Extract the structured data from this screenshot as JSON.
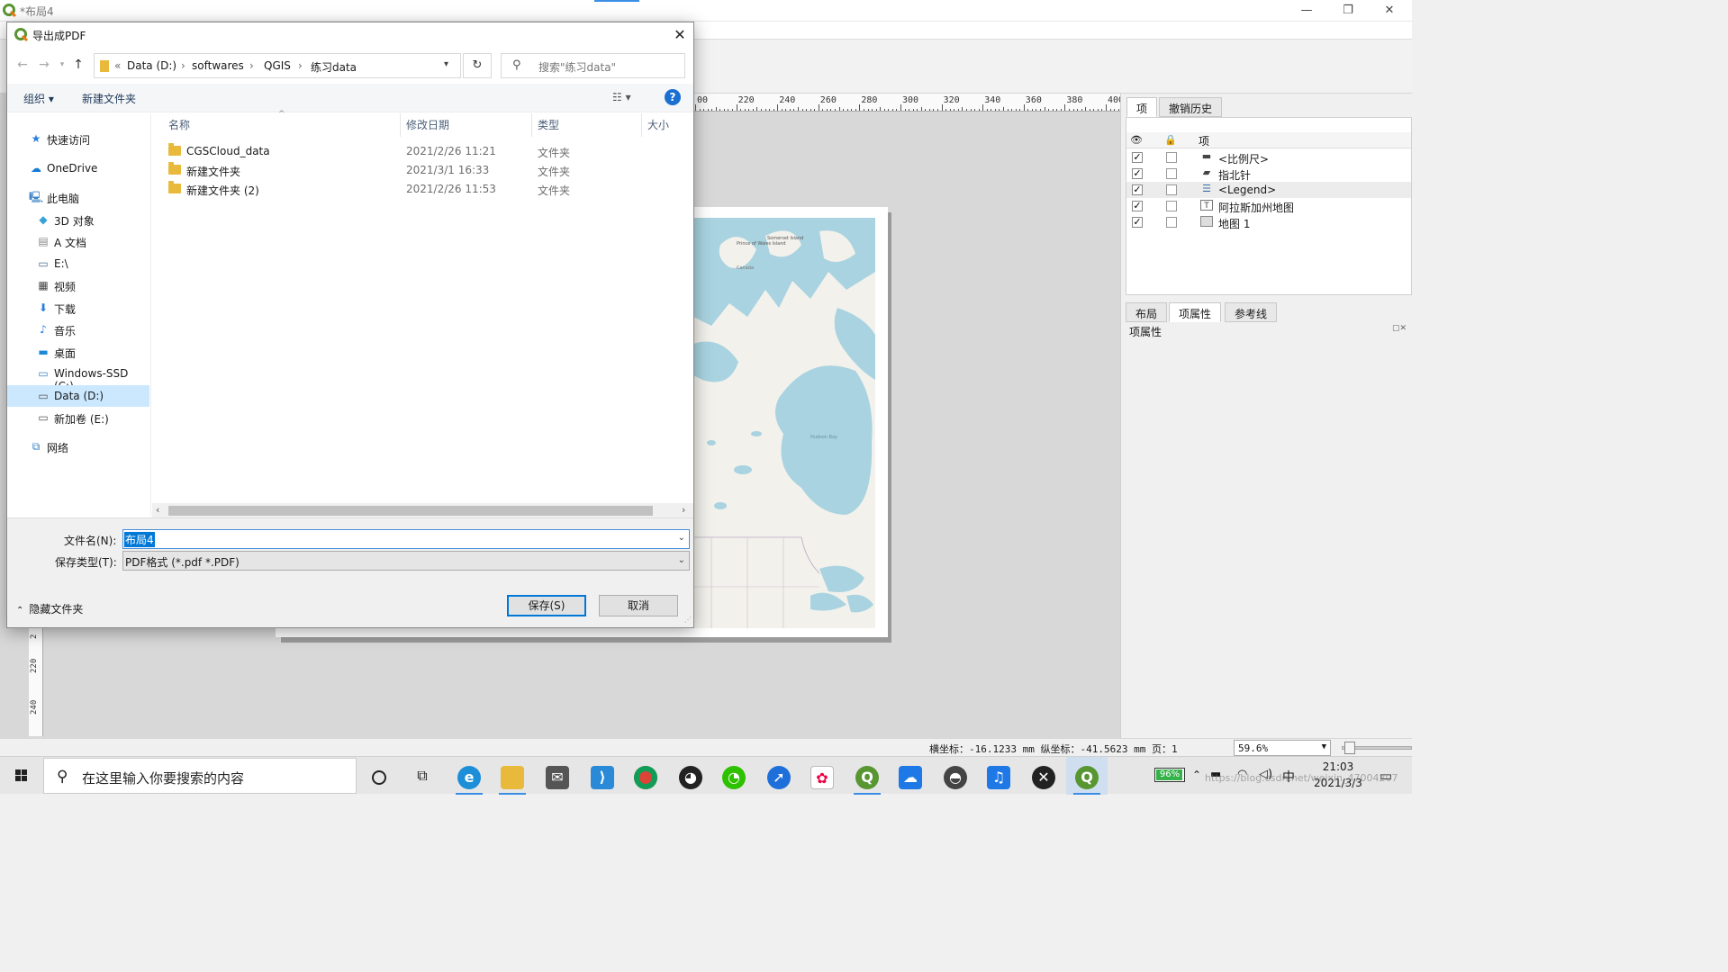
{
  "qgis": {
    "window_title": "*布局4",
    "ruler_h_labels": [
      "00",
      "220",
      "240",
      "260",
      "280",
      "300",
      "320",
      "340",
      "360",
      "380",
      "400"
    ],
    "ruler_v_labels": [
      "2",
      "220",
      "240"
    ],
    "dock_tabs_top": [
      "项",
      "撤销历史"
    ],
    "items_panel_title": "项",
    "items_header_label": "项",
    "items": [
      {
        "label": "<比例尺>",
        "checked": "✓",
        "icon": "scalebar-icon"
      },
      {
        "label": "指北针",
        "checked": "✓",
        "icon": "north-arrow-icon"
      },
      {
        "label": "<Legend>",
        "checked": "✓",
        "icon": "legend-icon"
      },
      {
        "label": "阿拉斯加州地图",
        "checked": "✓",
        "icon": "text-label-icon"
      },
      {
        "label": "地图 1",
        "checked": "✓",
        "icon": "map-item-icon"
      }
    ],
    "dock_tabs_bottom": [
      "布局",
      "项属性",
      "参考线"
    ],
    "properties_title": "项属性",
    "status_coords": "横坐标：-16.1233 mm 纵坐标：-41.5623 mm 页：1",
    "zoom": "59.6%",
    "zoom_slider_level": 0.05,
    "map_labels": {
      "pow": "Prince of Wales Island",
      "somerset": "Somerset Island",
      "canada": "Canada",
      "hudson": "Hudson Bay"
    }
  },
  "dialog": {
    "title": "导出成PDF",
    "close": "✕",
    "breadcrumb": [
      "«",
      "Data (D:)",
      "›",
      "softwares",
      "›",
      "QGIS",
      "›",
      "练习data"
    ],
    "search_placeholder": "搜索\"练习data\"",
    "organize": "组织 ▾",
    "new_folder": "新建文件夹",
    "view_toggle": "☷ ▾",
    "help": "?",
    "nav": [
      {
        "label": "快速访问",
        "icon": "star-icon"
      },
      {
        "label": "OneDrive",
        "icon": "cloud-icon"
      },
      {
        "label": "此电脑",
        "icon": "computer-icon"
      },
      {
        "label": "3D 对象",
        "icon": "cube-icon"
      },
      {
        "label": "A 文档",
        "icon": "document-icon"
      },
      {
        "label": "E:\\",
        "icon": "drive-icon"
      },
      {
        "label": "视频",
        "icon": "video-icon"
      },
      {
        "label": "下载",
        "icon": "download-icon"
      },
      {
        "label": "音乐",
        "icon": "music-icon"
      },
      {
        "label": "桌面",
        "icon": "desktop-icon"
      },
      {
        "label": "Windows-SSD (C:)",
        "icon": "drive-icon"
      },
      {
        "label": "Data (D:)",
        "icon": "drive-icon"
      },
      {
        "label": "新加卷 (E:)",
        "icon": "drive-icon"
      },
      {
        "label": "网络",
        "icon": "network-icon"
      }
    ],
    "columns": [
      "名称",
      "修改日期",
      "类型",
      "大小"
    ],
    "files": [
      {
        "name": "CGSCloud_data",
        "date": "2021/2/26 11:21",
        "type": "文件夹"
      },
      {
        "name": "新建文件夹",
        "date": "2021/3/1 16:33",
        "type": "文件夹"
      },
      {
        "name": "新建文件夹 (2)",
        "date": "2021/2/26 11:53",
        "type": "文件夹"
      }
    ],
    "filename_label": "文件名(N):",
    "filename_value": "布局4",
    "filetype_label": "保存类型(T):",
    "filetype_value": "PDF格式 (*.pdf *.PDF)",
    "hide_folders": "隐藏文件夹",
    "save": "保存(S)",
    "cancel": "取消"
  },
  "taskbar": {
    "search_placeholder": "在这里输入你要搜索的内容",
    "battery": "96%",
    "battery_level": 0.96,
    "ime": "中",
    "time": "21:03",
    "date": "2021/3/3",
    "watermark": "https://blog.csdn.net/weixin_47004207"
  },
  "colors": {
    "accent": "#0078d7",
    "water": "#a9d3e0",
    "land": "#f2f1ec",
    "qgis_green": "#589632"
  }
}
